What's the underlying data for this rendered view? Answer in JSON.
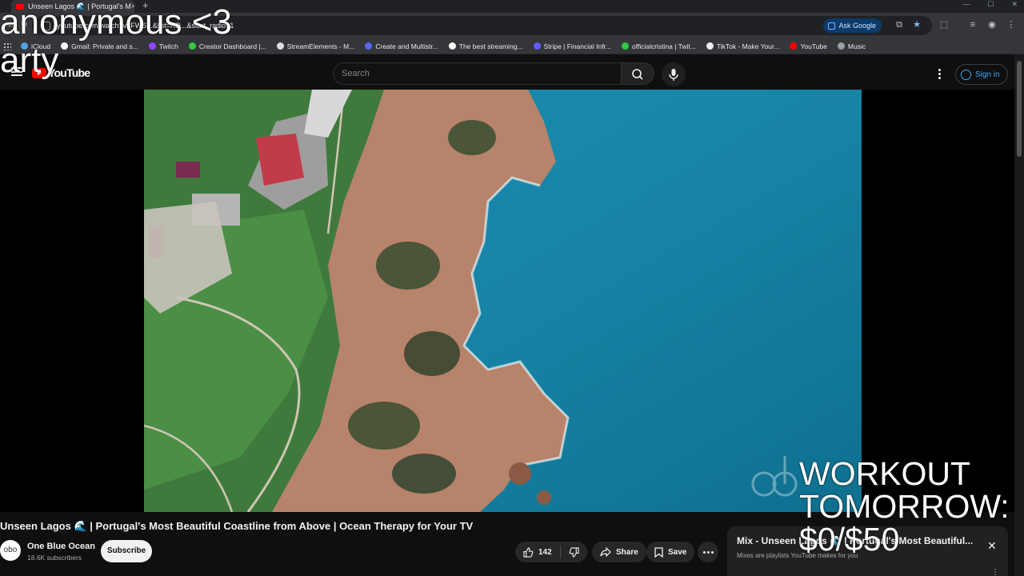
{
  "browser": {
    "tab_title": "Unseen Lagos 🌊 | Portugal's M",
    "url": "youtube.com/watch?v=FWS...&list=RD...&start_radio=1",
    "ask_google": "Ask Google",
    "bookmarks": [
      {
        "label": "iCloud",
        "color": "#4fa3e3"
      },
      {
        "label": "Gmail: Private and s...",
        "color": "#ffffff"
      },
      {
        "label": "Twitch",
        "color": "#9146ff"
      },
      {
        "label": "Creator Dashboard |...",
        "color": "#2ecc40"
      },
      {
        "label": "StreamElements - M...",
        "color": "#dddddd"
      },
      {
        "label": "Create and Multistr...",
        "color": "#5865f2"
      },
      {
        "label": "The best streaming...",
        "color": "#ffffff"
      },
      {
        "label": "Stripe | Financial Infr...",
        "color": "#635bff"
      },
      {
        "label": "officialcristina | Twit...",
        "color": "#2ecc40"
      },
      {
        "label": "TikTok - Make Your...",
        "color": "#eeeeee"
      },
      {
        "label": "YouTube",
        "color": "#ff0000"
      },
      {
        "label": "Music",
        "color": "#9aa0a6"
      }
    ]
  },
  "youtube": {
    "logo_text": "YouTube",
    "search_placeholder": "Search",
    "sign_in": "Sign in"
  },
  "video": {
    "title": "Unseen Lagos 🌊 | Portugal's Most Beautiful Coastline from Above | Ocean Therapy for Your TV",
    "channel_name": "One Blue Ocean",
    "channel_avatar_text": "obo",
    "subscribers": "18.6K subscribers",
    "subscribe_label": "Subscribe",
    "likes": "142",
    "share_label": "Share",
    "save_label": "Save"
  },
  "mix": {
    "title": "Mix - Unseen Lagos 🌊 | Portugal's Most Beautiful...",
    "subtitle": "Mixes are playlists YouTube makes for you"
  },
  "overlay": {
    "line1": "anonymous <3",
    "line2": "arty",
    "goal_line1": "WORKOUT",
    "goal_line2": "TOMORROW:",
    "goal_line3": "$0/$50"
  }
}
